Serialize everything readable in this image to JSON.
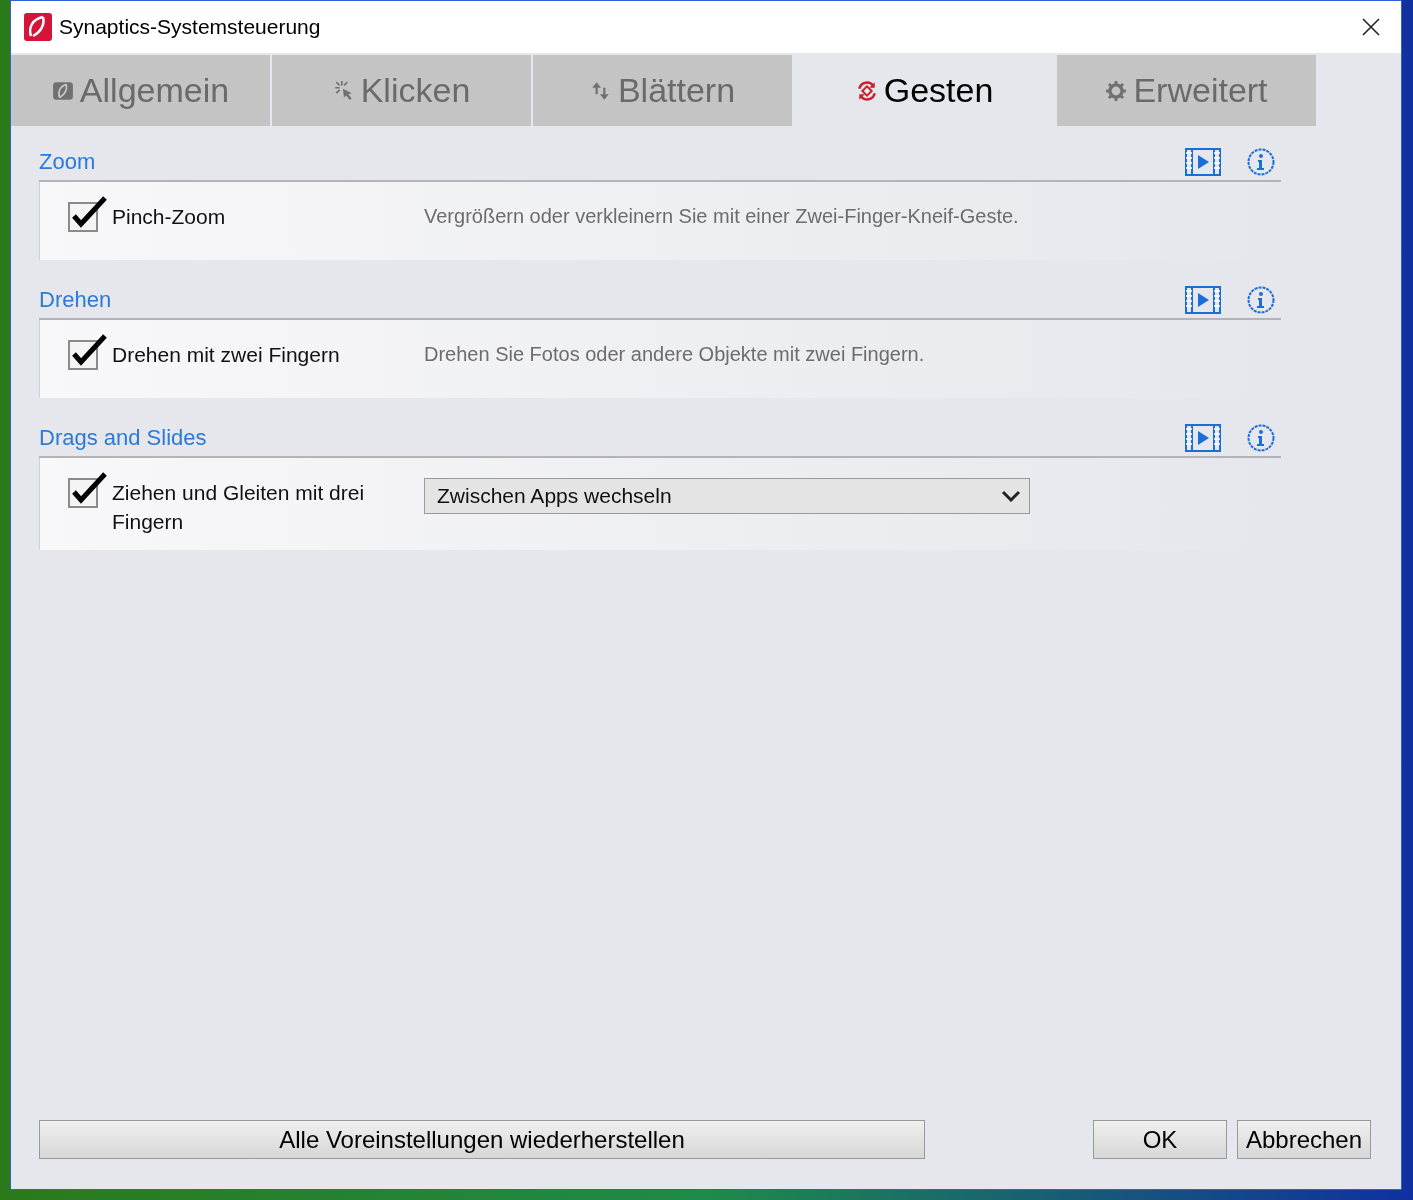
{
  "window": {
    "title": "Synaptics-Systemsteuerung"
  },
  "tabs": [
    {
      "label": "Allgemein",
      "kind": "logo",
      "selected": false
    },
    {
      "label": "Klicken",
      "kind": "click",
      "selected": false
    },
    {
      "label": "Blättern",
      "kind": "scroll",
      "selected": false
    },
    {
      "label": "Gesten",
      "kind": "gesture",
      "selected": true
    },
    {
      "label": "Erweitert",
      "kind": "gear",
      "selected": false
    }
  ],
  "sections": [
    {
      "title": "Zoom",
      "items": [
        {
          "kind": "checkbox",
          "label": "Pinch-Zoom",
          "checked": true,
          "description": "Vergrößern oder verkleinern Sie mit einer Zwei-Finger-Kneif-Geste."
        }
      ]
    },
    {
      "title": "Drehen",
      "items": [
        {
          "kind": "checkbox",
          "label": "Drehen mit zwei Fingern",
          "checked": true,
          "description": "Drehen Sie Fotos oder andere Objekte mit zwei Fingern."
        }
      ]
    },
    {
      "title": "Drags and Slides",
      "items": [
        {
          "kind": "dropdown",
          "label": "Ziehen und Gleiten mit drei Fingern",
          "checked": true,
          "value": "Zwischen Apps wechseln"
        }
      ]
    }
  ],
  "buttons": {
    "restore": "Alle Voreinstellungen wiederherstellen",
    "ok": "OK",
    "cancel": "Abbrechen"
  }
}
